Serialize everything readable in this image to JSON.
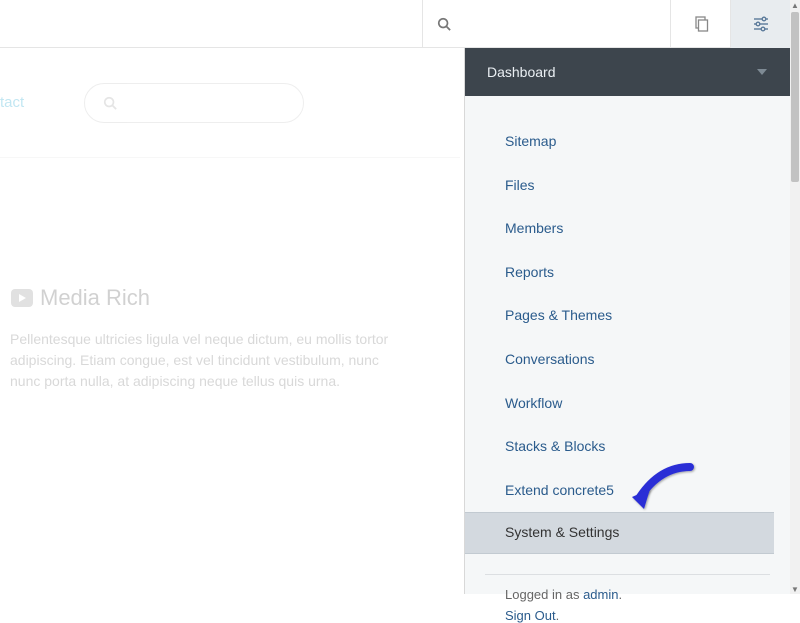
{
  "toolbar": {
    "search_placeholder": ""
  },
  "site": {
    "nav": {
      "contact": "tact"
    },
    "search_placeholder": ""
  },
  "content": {
    "heading": "Media Rich",
    "body": "Pellentesque ultricies ligula vel neque dictum, eu mollis tortor adipiscing. Etiam congue, est vel tincidunt vestibulum, nunc nunc porta nulla, at adipiscing neque tellus quis urna."
  },
  "panel": {
    "title": "Dashboard",
    "items": [
      {
        "label": "Sitemap",
        "highlight": false
      },
      {
        "label": "Files",
        "highlight": false
      },
      {
        "label": "Members",
        "highlight": false
      },
      {
        "label": "Reports",
        "highlight": false
      },
      {
        "label": "Pages & Themes",
        "highlight": false
      },
      {
        "label": "Conversations",
        "highlight": false
      },
      {
        "label": "Workflow",
        "highlight": false
      },
      {
        "label": "Stacks & Blocks",
        "highlight": false
      },
      {
        "label": "Extend concrete5",
        "highlight": false
      },
      {
        "label": "System & Settings",
        "highlight": true
      }
    ],
    "footer": {
      "logged_in_prefix": "Logged in as ",
      "user": "admin",
      "logged_in_suffix": ".",
      "sign_out": "Sign Out"
    }
  },
  "annotation": {
    "arrow_color": "#2a2fd6"
  }
}
